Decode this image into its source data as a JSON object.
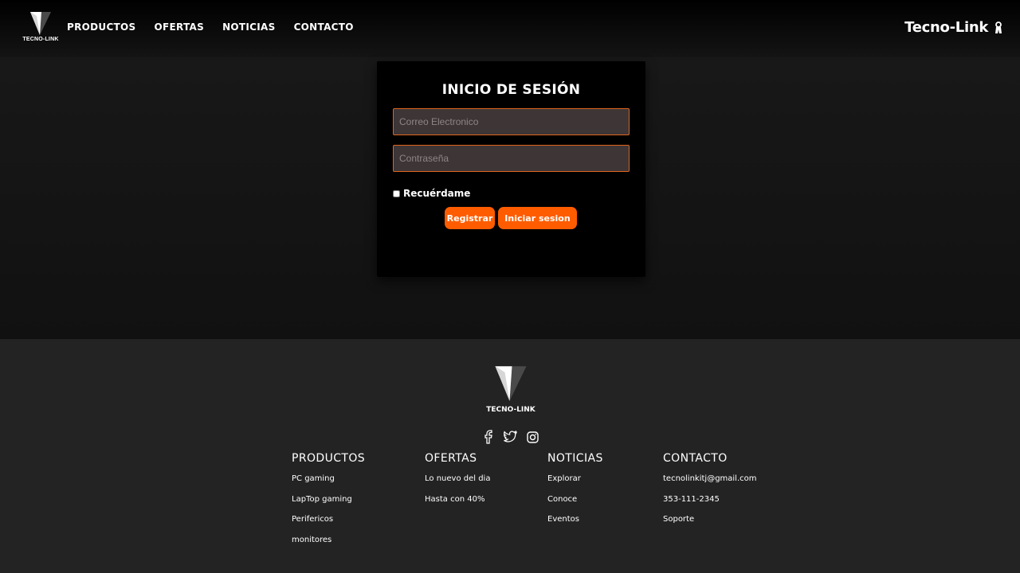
{
  "header": {
    "logo_text": "TECNO-LINK",
    "nav": [
      "PRODUCTOS",
      "OFERTAS",
      "NOTICIAS",
      "CONTACTO"
    ],
    "brand": "Tecno-Link",
    "brand_icon": "user-icon"
  },
  "login": {
    "title": "INICIO DE SESIÓN",
    "email_placeholder": "Correo Electronico",
    "password_placeholder": "Contraseña",
    "remember_label": "Recuérdame",
    "register_label": "Registrar",
    "login_label": "Iniciar sesion"
  },
  "footer": {
    "logo_text": "TECNO-LINK",
    "socials": [
      "facebook-icon",
      "twitter-icon",
      "instagram-icon"
    ],
    "columns": [
      {
        "title": "PRODUCTOS",
        "items": [
          "PC gaming",
          "LapTop gaming",
          "Perifericos",
          "monitores"
        ]
      },
      {
        "title": "OFERTAS",
        "items": [
          "Lo nuevo del dia",
          "Hasta con 40%"
        ]
      },
      {
        "title": "NOTICIAS",
        "items": [
          "Explorar",
          "Conoce",
          "Eventos"
        ]
      },
      {
        "title": "CONTACTO",
        "items": [
          "tecnolinkitj@gmail.com",
          "353-111-2345",
          "Soporte"
        ]
      }
    ]
  },
  "colors": {
    "accent": "#ff5c00",
    "header_bg": "#000000",
    "footer_bg": "#232323",
    "field_bg": "#3d3536",
    "field_border": "#e0641c"
  }
}
